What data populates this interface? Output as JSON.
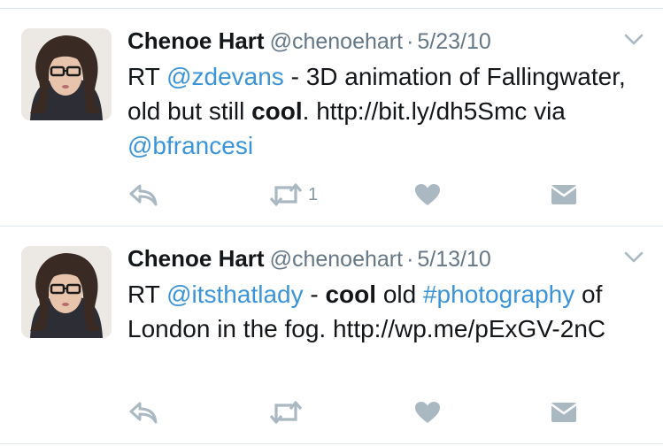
{
  "tweets": [
    {
      "author": "Chenoe Hart",
      "handle": "@chenoehart",
      "separator": "·",
      "date": "5/23/10",
      "text": {
        "p1": "RT ",
        "mention1": "@zdevans",
        "p2": " - 3D animation of Fallingwater, old but still ",
        "bold": "cool",
        "p3": ". http://bit.ly/dh5Smc via ",
        "mention2": "@bfrancesi"
      },
      "retweet_count": "1",
      "icons": {
        "reply": "reply-icon",
        "retweet": "retweet-icon",
        "like": "heart-icon",
        "dm": "envelope-icon",
        "more": "chevron-down-icon"
      }
    },
    {
      "author": "Chenoe Hart",
      "handle": "@chenoehart",
      "separator": "·",
      "date": "5/13/10",
      "text": {
        "p1": "RT ",
        "mention1": "@itsthatlady",
        "p2": " - ",
        "bold": "cool",
        "p3": " old ",
        "hashtag": "#photography",
        "p4": " of London in the fog. http://wp.me/pExGV-2nC"
      },
      "retweet_count": "",
      "icons": {
        "reply": "reply-icon",
        "retweet": "retweet-icon",
        "like": "heart-icon",
        "dm": "envelope-icon",
        "more": "chevron-down-icon"
      }
    }
  ],
  "colors": {
    "link": "#3b94d9",
    "meta": "#657786",
    "icon": "#aab8c2",
    "divider": "#e1e8ed"
  }
}
